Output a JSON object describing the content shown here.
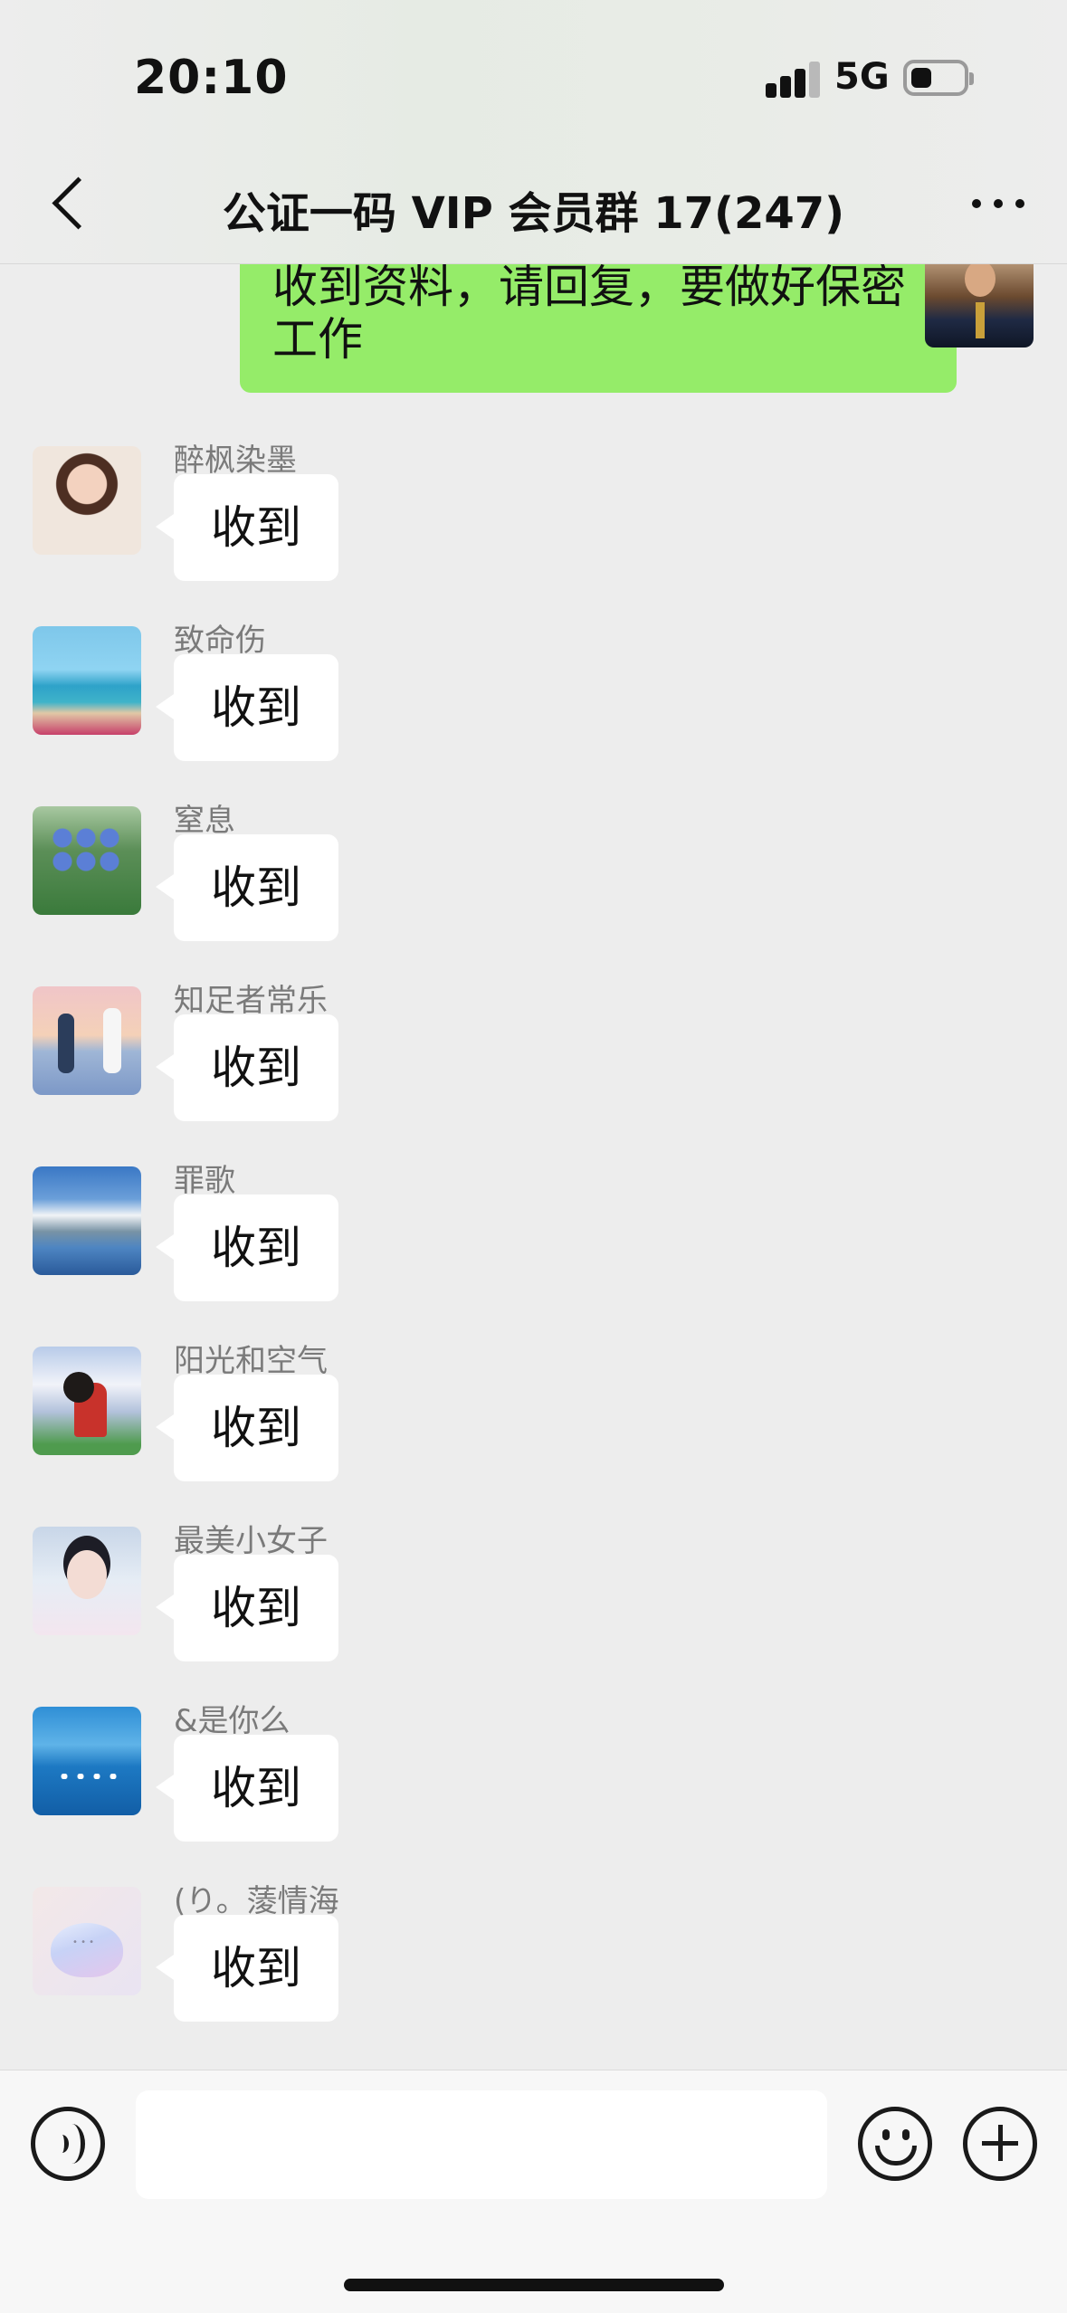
{
  "status_bar": {
    "time": "20:10",
    "network": "5G"
  },
  "nav": {
    "title": "公证一码 VIP 会员群 17(247)"
  },
  "self_message": {
    "text": "收到资料，请回复，要做好保密工作"
  },
  "messages": [
    {
      "sender": "醉枫染墨",
      "text": "收到"
    },
    {
      "sender": "致命伤",
      "text": "收到"
    },
    {
      "sender": "窒息",
      "text": "收到"
    },
    {
      "sender": "知足者常乐",
      "text": "收到"
    },
    {
      "sender": "罪歌",
      "text": "收到"
    },
    {
      "sender": " 阳光和空气",
      "text": "收到"
    },
    {
      "sender": "最美小女子",
      "text": "收到"
    },
    {
      "sender": "&是你么",
      "text": "收到"
    },
    {
      "sender": "(り。蔆情海",
      "text": "收到"
    }
  ],
  "input": {
    "placeholder": ""
  },
  "colors": {
    "self_bubble": "#95ec69",
    "other_bubble": "#ffffff",
    "background": "#ededed"
  }
}
